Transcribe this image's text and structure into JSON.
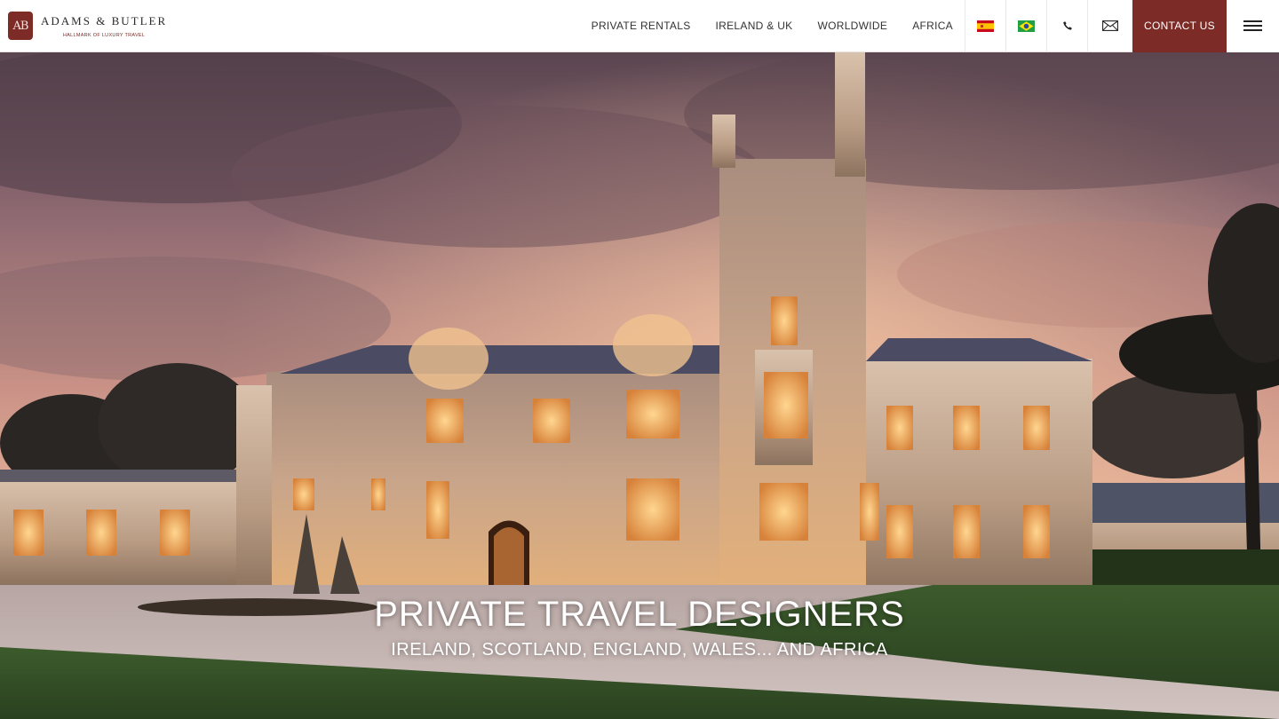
{
  "brand": {
    "monogram": "AB",
    "name": "ADAMS & BUTLER",
    "tagline": "HALLMARK OF LUXURY TRAVEL",
    "color": "#7c2b26"
  },
  "nav": {
    "links": [
      "PRIVATE RENTALS",
      "IRELAND & UK",
      "WORLDWIDE",
      "AFRICA"
    ],
    "language_flags": [
      "spain-flag-icon",
      "brazil-flag-icon"
    ],
    "phone_icon": "phone-icon",
    "email_icon": "envelope-icon",
    "contact_label": "CONTACT US",
    "menu_icon": "hamburger-menu-icon"
  },
  "hero": {
    "title": "PRIVATE TRAVEL DESIGNERS",
    "subtitle": "IRELAND, SCOTLAND, ENGLAND, WALES... AND AFRICA",
    "image": "illuminated castle at dusk"
  }
}
